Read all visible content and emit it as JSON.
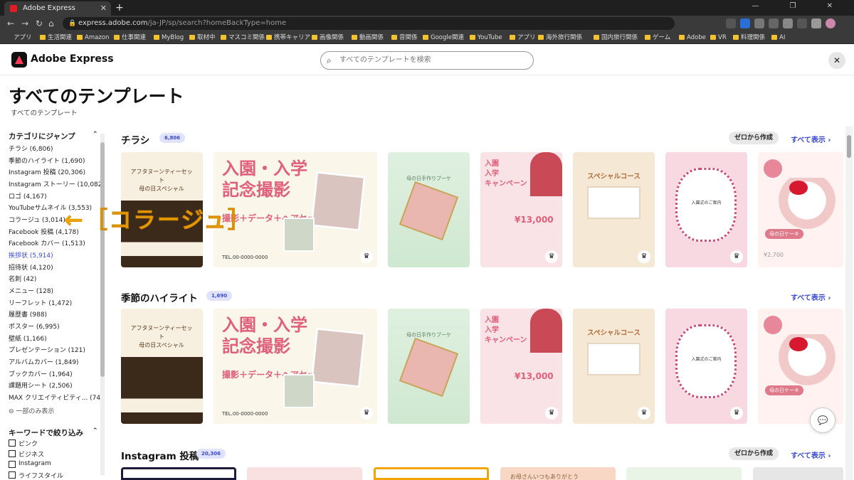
{
  "browser": {
    "tab_title": "Adobe Express",
    "tab_close": "✕",
    "new_tab": "+",
    "window_controls": "—  ❐  ✕",
    "url_host": "express.adobe.com",
    "url_path": "/ja-JP/sp/search?homeBackType=home",
    "bookmarks": [
      "アプリ",
      "生活関連",
      "Amazon",
      "仕事関連",
      "MyBlog",
      "取材中",
      "マスコミ関係",
      "携帯キャリア",
      "画像関係",
      "動画関係",
      "音関係",
      "Google関連",
      "YouTube",
      "アプリ",
      "海外旅行関係",
      "国内旅行関係",
      "ゲーム",
      "Adobe",
      "VR",
      "料理関係",
      "AI"
    ]
  },
  "header": {
    "brand": "Adobe Express",
    "search_placeholder": "すべてのテンプレートを検索",
    "close": "✕"
  },
  "page": {
    "title": "すべてのテンプレート",
    "breadcrumb": "すべてのテンプレート"
  },
  "sidebar": {
    "category_heading": "カテゴリにジャンプ",
    "categories": [
      "チラシ (6,806)",
      "季節のハイライト (1,690)",
      "Instagram 投稿 (20,306)",
      "Instagram ストーリー (10,082)",
      "ロゴ (4,167)",
      "YouTubeサムネイル (3,553)",
      "コラージュ (3,014)",
      "Facebook 投稿 (4,178)",
      "Facebook カバー (1,513)",
      "挨拶状 (5,914)",
      "招待状 (4,120)",
      "名刺 (42)",
      "メニュー (128)",
      "リーフレット (1,472)",
      "履歴書 (988)",
      "ポスター (6,995)",
      "壁紙 (1,166)",
      "プレゼンテーション (121)",
      "アルバムカバー (1,849)",
      "ブックカバー (1,964)",
      "課題用シート (2,506)",
      "MAX クリエイティビティ...   (74)"
    ],
    "show_less": "⊖ 一部のみ表示",
    "keyword_heading": "キーワードで絞り込み",
    "keywords": [
      "ピンク",
      "ビジネス",
      "Instagram",
      "ライフスタイル"
    ]
  },
  "annotation": "←［コラージュ］",
  "sections": [
    {
      "title": "チラシ",
      "count": "6,806",
      "create": "ゼロから作成",
      "see_all": "すべて表示 ›"
    },
    {
      "title": "季節のハイライト",
      "count": "1,690",
      "see_all": "すべて表示 ›"
    },
    {
      "title": "Instagram 投稿",
      "count": "20,306",
      "create": "ゼロから作成",
      "see_all": "すべて表示 ›"
    }
  ],
  "cards": {
    "c1_text": "アフタヌーンティーセット\n母の日スペシャル",
    "c2_title": "入園・入学\n記念撮影",
    "c2_sub": "撮影＋データ＋ヘアセット",
    "c2_tel": "TEL.00-0000-0000",
    "c3_text": "母の日手作りブーケ",
    "c4_title": "入園\n入学\nキャンペーン",
    "c4_price": "¥13,000",
    "c5_title": "スペシャルコース",
    "c6_text": "入園式のご案内",
    "c7_label": "母の日ケーキ",
    "c7_price": "¥2,700",
    "ig4_text": "お母さんいつもありがとう"
  },
  "icons": {
    "crown": "♛",
    "chat": "💬",
    "search": "⌕"
  }
}
